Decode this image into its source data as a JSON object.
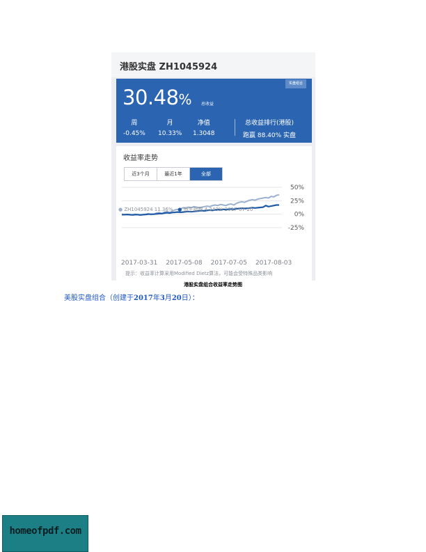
{
  "screenshot": {
    "title": "港股实盘 ZH1045924",
    "hero": {
      "tag": "实盘组合",
      "big_value": "30.48",
      "big_unit": "%",
      "sub_label": "总收益",
      "stats": [
        {
          "label": "周",
          "value": "-0.45%"
        },
        {
          "label": "月",
          "value": "10.33%"
        },
        {
          "label": "净值",
          "value": "1.3048"
        },
        {
          "label": "总收益排行(港股)",
          "value": "跑赢 88.40% 实盘"
        }
      ]
    },
    "trend": {
      "title": "收益率走势",
      "tabs": [
        "近3个月",
        "最近1年",
        "全部"
      ],
      "active_tab": "全部",
      "legend": {
        "series1": "ZH1045924 11.36%",
        "series2": "恒生指数 4.243% 2017-07-20"
      },
      "dates": [
        "2017-03-31",
        "2017-05-08",
        "2017-07-05",
        "2017-08-03"
      ],
      "tip": "提示：收益率计算采用Modified Dietz算法，可能会受特殊品类影响"
    }
  },
  "chart_data": {
    "type": "line",
    "y_ticks": [
      "50%",
      "25%",
      "0%",
      "-25%"
    ],
    "ylim": [
      -25,
      50
    ],
    "x_points": 60,
    "series": [
      {
        "name": "ZH1045924",
        "color": "#9bb0cf",
        "values": [
          0,
          -1,
          -0.5,
          -1.5,
          -1,
          0,
          -1,
          -2,
          -1,
          0,
          1,
          -1,
          0,
          2,
          3,
          1,
          4,
          5,
          3,
          6,
          8,
          9,
          10,
          12,
          11,
          13,
          12,
          14,
          13,
          12,
          13,
          14,
          15,
          14,
          16,
          17,
          16,
          18,
          17,
          16,
          18,
          19,
          17,
          20,
          22,
          23,
          22,
          24,
          26,
          27,
          26,
          28,
          29,
          30,
          31,
          30,
          33,
          32,
          35,
          36
        ]
      },
      {
        "name": "恒生指数",
        "color": "#1f5aa6",
        "values": [
          -1,
          -1,
          -0.5,
          -1,
          -1.5,
          -1,
          -1,
          -1.5,
          -1,
          -0.5,
          0,
          0,
          0,
          0.5,
          1,
          1,
          2,
          2.5,
          2,
          3,
          3.5,
          4,
          3.5,
          4,
          4.5,
          5,
          4.5,
          5,
          5.5,
          6,
          6.5,
          6,
          7,
          7.5,
          7,
          8,
          8.5,
          8,
          9,
          8.5,
          9,
          9.5,
          9,
          10,
          10.5,
          11,
          10.5,
          11,
          11.5,
          12,
          11.5,
          12,
          12.5,
          13,
          16,
          14,
          15,
          16,
          17,
          17
        ]
      }
    ]
  },
  "caption": "港股实盘组合收益率走势图",
  "paragraph": {
    "part1": "美股实盘组合（创建于",
    "year": "2017",
    "year_unit": "年",
    "month": "3",
    "month_unit": "月",
    "day": "20",
    "day_unit": "日）："
  },
  "watermark": "homeofpdf.com"
}
